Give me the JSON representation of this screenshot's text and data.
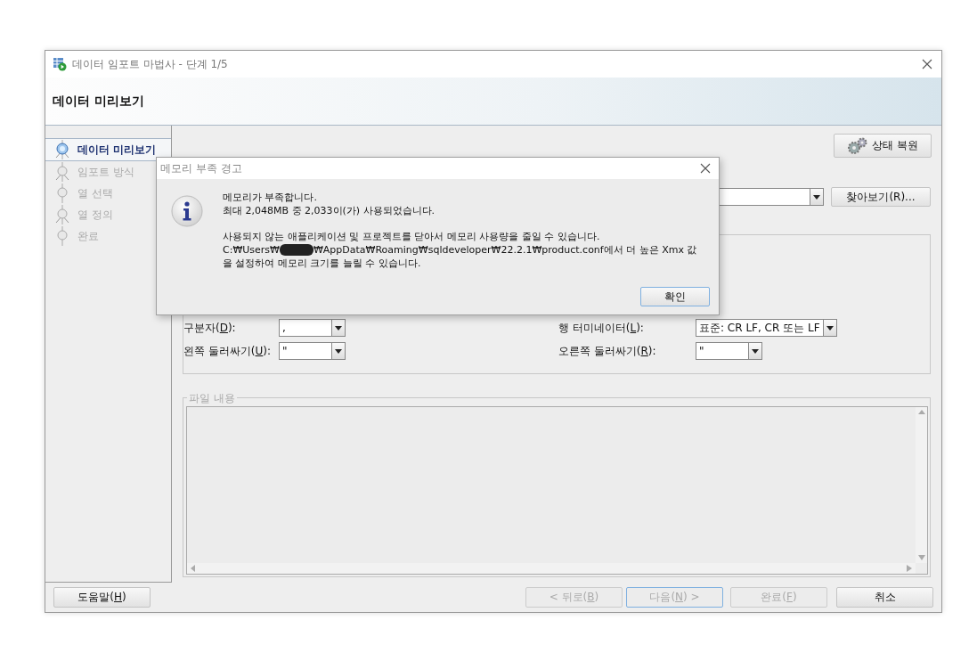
{
  "window": {
    "title": "데이터 임포트 마법사 - 단계 1/5"
  },
  "header": {
    "title": "데이터 미리보기"
  },
  "steps": [
    {
      "label": "데이터 미리보기",
      "selected": true,
      "kind": "branch"
    },
    {
      "label": "임포트 방식",
      "selected": false,
      "kind": "branch"
    },
    {
      "label": "열 선택",
      "selected": false,
      "kind": "dot"
    },
    {
      "label": "열 정의",
      "selected": false,
      "kind": "branch"
    },
    {
      "label": "완료",
      "selected": false,
      "kind": "dot"
    }
  ],
  "restore_button": {
    "label": "상태 복원"
  },
  "browse_button": {
    "label": "찾아보기(R)..."
  },
  "options": [
    {
      "pre": "구분자(",
      "key": "D",
      "post": "):",
      "value": ","
    },
    {
      "pre": "행 터미네이터(",
      "key": "L",
      "post": "):",
      "value": "표준: CR LF, CR 또는 LF"
    },
    {
      "pre": "왼쪽 둘러싸기(",
      "key": "U",
      "post": "):",
      "value": "\""
    },
    {
      "pre": "오른쪽 둘러싸기(",
      "key": "R",
      "post": "):",
      "value": "\""
    }
  ],
  "file_contents": {
    "legend": "파일 내용"
  },
  "buttons": [
    {
      "pre": "도움말(",
      "key": "H",
      "post": ")",
      "disabled": false,
      "default": false
    },
    {
      "pre": "< 뒤로(",
      "key": "B",
      "post": ")",
      "disabled": true,
      "default": false
    },
    {
      "pre": "다음(",
      "key": "N",
      "post": ") >",
      "disabled": true,
      "default": true
    },
    {
      "pre": "완료(",
      "key": "F",
      "post": ")",
      "disabled": true,
      "default": false
    },
    {
      "pre": "취소",
      "disabled": false,
      "default": false
    }
  ],
  "dialog": {
    "title": "메모리 부족 경고",
    "paragraphs": [
      [
        {
          "kind": "text",
          "text": "메모리가 부족합니다."
        },
        {
          "kind": "text",
          "text": "최대 2,048MB 중 2,033이(가) 사용되었습니다."
        }
      ],
      [
        {
          "kind": "text",
          "text": "사용되지 않는 애플리케이션 및 프로젝트를 닫아서 메모리 사용량을 줄일 수 있습니다."
        },
        {
          "kind": "redacted",
          "before": "C:₩Users₩",
          "after": "₩AppData₩Roaming₩sqldeveloper₩22.2.1₩product.conf에서 더 높은 Xmx 값"
        },
        {
          "kind": "text",
          "text": "을 설정하여 메모리 크기를 늘릴 수 있습니다."
        }
      ]
    ],
    "ok_button": "확인"
  }
}
